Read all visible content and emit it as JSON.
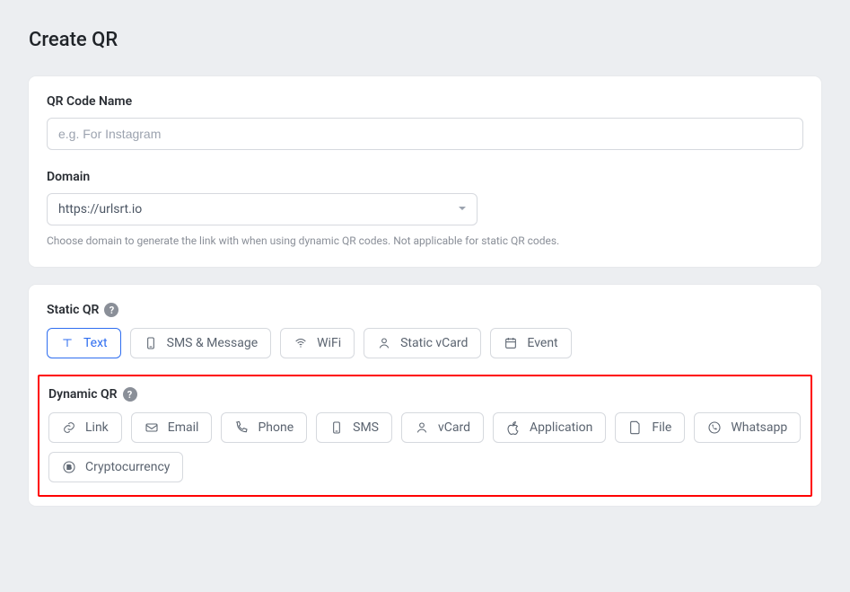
{
  "page_title": "Create QR",
  "form": {
    "name_label": "QR Code Name",
    "name_placeholder": "e.g. For Instagram",
    "domain_label": "Domain",
    "domain_value": "https://urlsrt.io",
    "domain_help": "Choose domain to generate the link with when using dynamic QR codes. Not applicable for static QR codes."
  },
  "static_section": {
    "title": "Static QR",
    "options": {
      "text": "Text",
      "sms_message": "SMS & Message",
      "wifi": "WiFi",
      "static_vcard": "Static vCard",
      "event": "Event"
    }
  },
  "dynamic_section": {
    "title": "Dynamic QR",
    "options": {
      "link": "Link",
      "email": "Email",
      "phone": "Phone",
      "sms": "SMS",
      "vcard": "vCard",
      "application": "Application",
      "file": "File",
      "whatsapp": "Whatsapp",
      "crypto": "Cryptocurrency"
    }
  }
}
